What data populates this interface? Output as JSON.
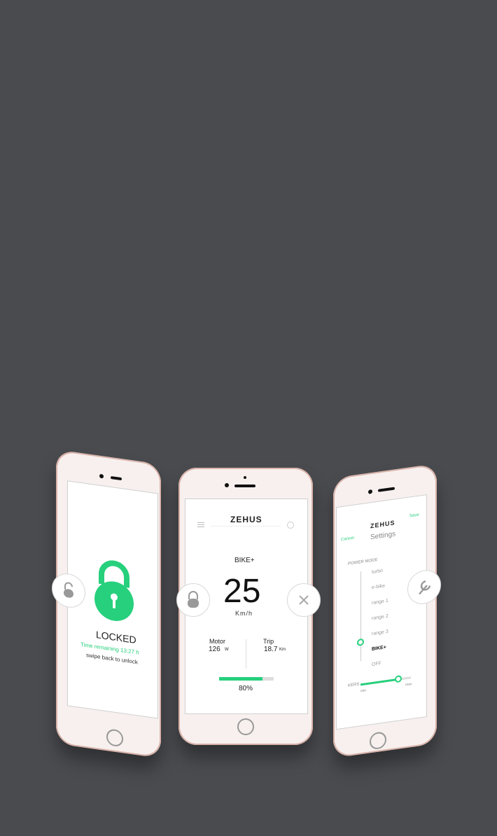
{
  "background_color": "#4a4b4f",
  "accent_color": "#26d07c",
  "left_phone": {
    "status_title": "LOCKED",
    "time_remaining": "Time remaining 13:27 h",
    "swipe_hint": "swipe back to unlock"
  },
  "center_phone": {
    "brand": "ZEHUS",
    "mode": "BIKE+",
    "speed": "25",
    "speed_unit": "Km/h",
    "motor_label": "Motor",
    "motor_value": "126",
    "motor_unit": "W",
    "trip_label": "Trip",
    "trip_value": "18.7",
    "trip_unit": "Km",
    "battery_percent": "80%",
    "battery_level": 0.8
  },
  "right_phone": {
    "brand": "ZEHUS",
    "cancel_label": "Cancel",
    "save_label": "Save",
    "title": "Settings",
    "section_label": "POWER MODE",
    "modes": [
      "turbo",
      "e-bike",
      "range 1",
      "range 2",
      "range 3",
      "BIKE+",
      "OFF"
    ],
    "selected_mode": "BIKE+",
    "kers_label": "KERS",
    "kers_min": "min",
    "kers_max": "max",
    "kers_level": 0.75
  }
}
